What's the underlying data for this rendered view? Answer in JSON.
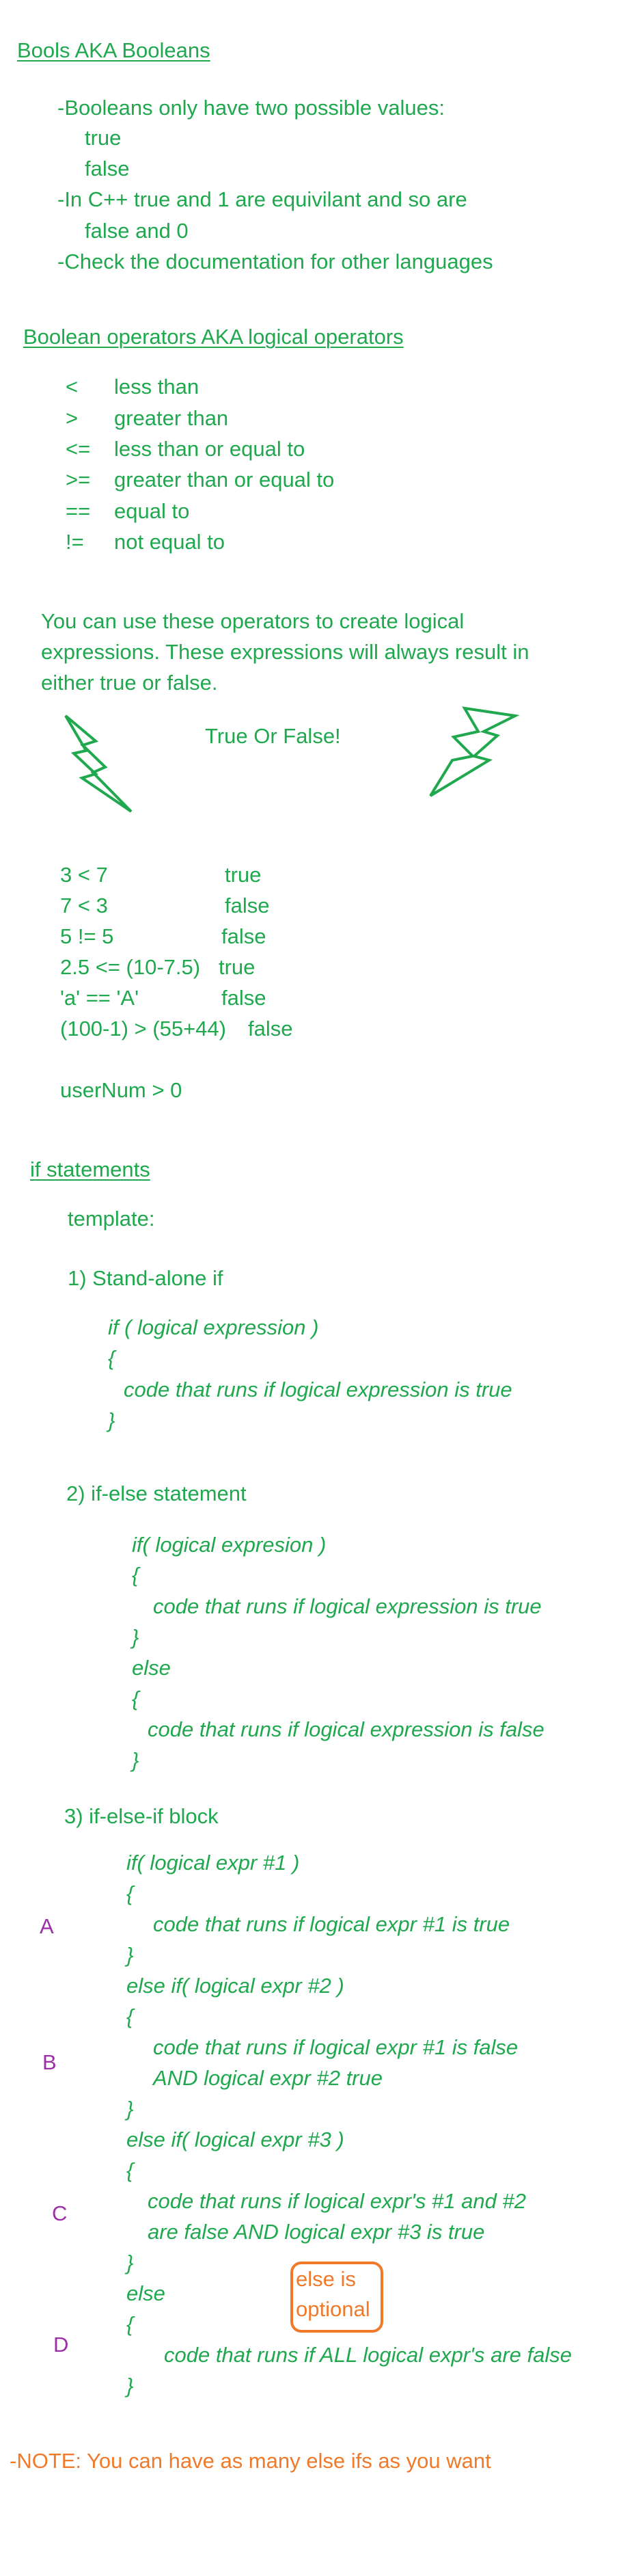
{
  "colors": {
    "green": "#1fa84e",
    "purple": "#9b2fa6",
    "orange": "#f07a2a"
  },
  "bools": {
    "heading": "Bools AKA Booleans",
    "lines": [
      "-Booleans only have two possible values:",
      "true",
      "false",
      "-In C++ true and 1 are equivilant and so are",
      "false and 0",
      "-Check the documentation for other languages"
    ]
  },
  "operators": {
    "heading": "Boolean operators AKA logical operators",
    "items": [
      {
        "symbol": "<",
        "meaning": "less than"
      },
      {
        "symbol": ">",
        "meaning": "greater than"
      },
      {
        "symbol": "<=",
        "meaning": "less than or equal to"
      },
      {
        "symbol": ">=",
        "meaning": "greater than or equal to"
      },
      {
        "symbol": "==",
        "meaning": "equal to"
      },
      {
        "symbol": "!=",
        "meaning": "not equal to"
      }
    ]
  },
  "expressions": {
    "intro": [
      "You can use these operators to create logical",
      "expressions. These expressions will always result in",
      "either true or false."
    ],
    "banner": "True Or False!",
    "left_icon": "lightning-bolt-icon",
    "right_icon": "lightning-bolt-icon",
    "examples": [
      {
        "expr": "3 < 7",
        "result": "true"
      },
      {
        "expr": "7 < 3",
        "result": "false"
      },
      {
        "expr": "5 != 5",
        "result": "false"
      },
      {
        "expr": "2.5 <= (10-7.5)",
        "result": "true"
      },
      {
        "expr": "'a' == 'A'",
        "result": "false"
      },
      {
        "expr": "(100-1) > (55+44)",
        "result": "false"
      }
    ],
    "user_expr": "userNum > 0"
  },
  "if_statements": {
    "heading": "if statements",
    "template_label": "template:",
    "standalone": {
      "title": "1) Stand-alone if",
      "code": [
        "if ( logical expression )",
        "{",
        "code that runs if logical expression is true",
        "}"
      ]
    },
    "if_else": {
      "title": "2) if-else statement",
      "code": [
        "if( logical expresion )",
        "{",
        "code that runs if logical expression is true",
        "}",
        "else",
        "{",
        "code that runs if logical expression is false",
        "}"
      ]
    },
    "if_else_if": {
      "title": "3) if-else-if block",
      "code": [
        "if( logical expr #1 )",
        "{",
        "code that runs if logical expr #1 is true",
        "}",
        "else if( logical expr #2 )",
        "{",
        "code that runs if logical expr #1 is false",
        "AND logical expr #2 true",
        "}",
        "else if( logical expr #3 )",
        "{",
        "code that runs if logical expr's #1 and #2",
        "are false AND logical expr #3 is true",
        "}",
        "else",
        "{",
        "code that runs if ALL logical expr's are false",
        "}"
      ],
      "markers": [
        "A",
        "B",
        "C",
        "D"
      ],
      "callout": [
        "else is",
        "optional"
      ]
    },
    "note": "-NOTE: You can have as many else ifs as you want"
  }
}
